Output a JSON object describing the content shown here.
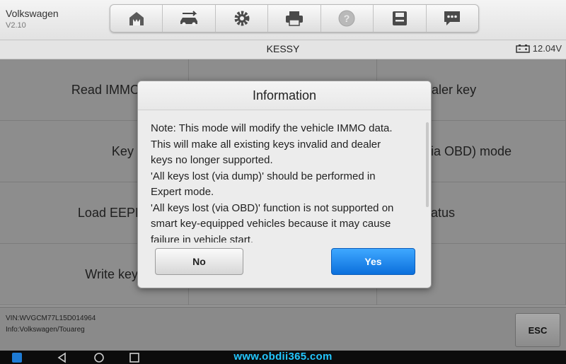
{
  "header": {
    "app_name": "Volkswagen",
    "version": "V2.10"
  },
  "toolbar": {
    "icons": [
      "home-icon",
      "vehicle-swap-icon",
      "settings-icon",
      "print-icon",
      "help-icon",
      "save-icon",
      "feedback-icon"
    ]
  },
  "title": {
    "text": "KESSY",
    "battery": "12.04V"
  },
  "functions": {
    "r1c1": "Read IMMO data of",
    "r1c3": "Make dealer key",
    "r2c1": "Key learning",
    "r2c3": "s Lost (via OBD) mode",
    "r3c1": "Load EEPROM da",
    "r3c3": "IMMO status",
    "r4c1": "Write key to ECU"
  },
  "footer": {
    "vin": "VIN:WVGCM77L15D014964",
    "info": "Info:Volkswagen/Touareg",
    "esc_label": "ESC"
  },
  "dialog": {
    "title": "Information",
    "lines": [
      "Note: This mode will modify the vehicle IMMO data.",
      "This will make all existing keys invalid and dealer",
      "keys no longer supported.",
      "'All keys lost (via dump)' should be performed in",
      "Expert mode.",
      "'All keys lost (via OBD)' function is not supported on",
      "smart key-equipped vehicles because it may cause",
      "failure in vehicle start."
    ],
    "no_label": "No",
    "yes_label": "Yes"
  },
  "watermark": "www.obdii365.com",
  "colors": {
    "yes_button": "#1a84f0",
    "watermark": "#23c7ff"
  }
}
